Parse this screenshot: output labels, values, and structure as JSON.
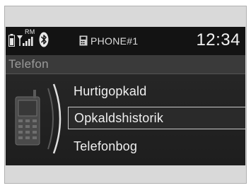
{
  "status_bar": {
    "roaming_badge": "RM",
    "phone_name": "PHONE#1",
    "clock": "12:34",
    "icons": [
      "battery-icon",
      "signal-strength-icon",
      "bluetooth-icon",
      "phone-device-icon"
    ]
  },
  "title": "Telefon",
  "menu": {
    "items": [
      {
        "label": "Hurtigopkald",
        "selected": false
      },
      {
        "label": "Opkaldshistorik",
        "selected": true
      },
      {
        "label": "Telefonbog",
        "selected": false
      }
    ]
  },
  "colors": {
    "screen_background": "#1a1a1a",
    "title_bar": "#3a3a3a",
    "highlight_border": "#c8c8c8",
    "text": "#f0f0f0"
  }
}
